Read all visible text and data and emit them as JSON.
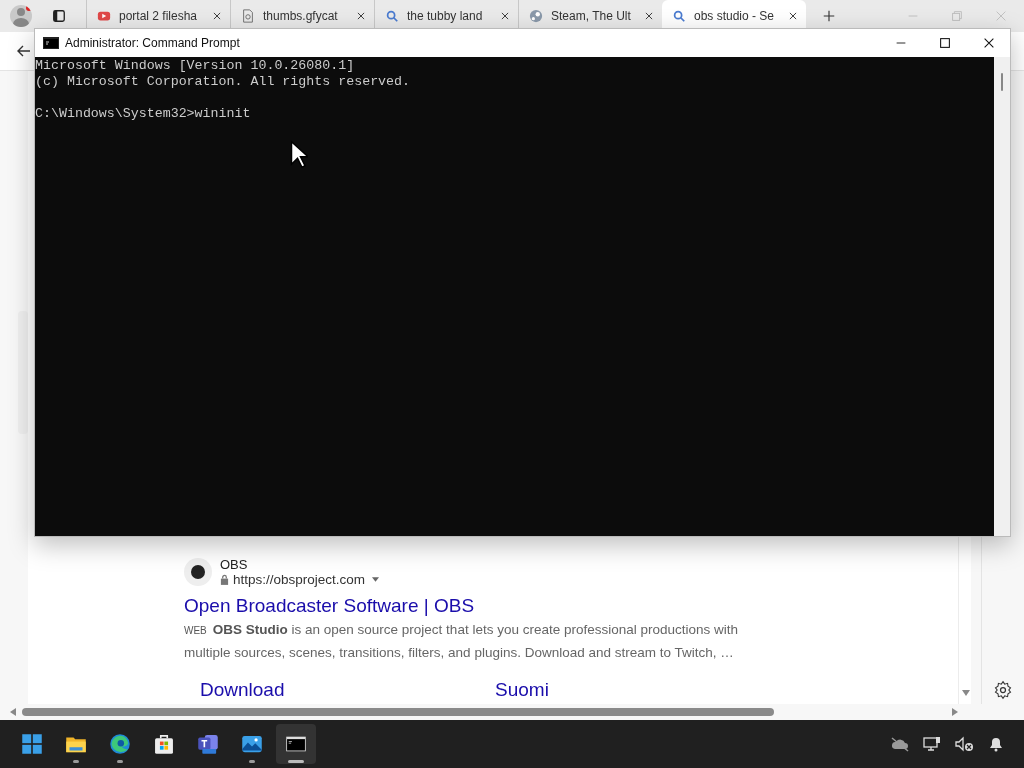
{
  "browser": {
    "tabs": [
      {
        "title": "portal 2 filesha",
        "kind": "video",
        "selected": false
      },
      {
        "title": "thumbs.gfycat",
        "kind": "document",
        "selected": false
      },
      {
        "title": "the tubby land",
        "kind": "search",
        "selected": false
      },
      {
        "title": "Steam, The Ult",
        "kind": "steam",
        "selected": false
      },
      {
        "title": "obs studio - Se",
        "kind": "search",
        "selected": true
      }
    ],
    "result": {
      "site": "OBS",
      "url": "https://obsproject.com",
      "title": "Open Broadcaster Software | OBS",
      "badge": "WEB",
      "snippet_lines": [
        "**OBS Studio** is an open source project that lets you create professional productions with",
        "multiple sources, scenes, transitions, filters, and plugins. Download and stream to Twitch, …"
      ],
      "sitelinks": [
        "Download",
        "Suomi"
      ]
    }
  },
  "console": {
    "title": "Administrator: Command Prompt",
    "lines": [
      "Microsoft Windows [Version 10.0.26080.1]",
      "(c) Microsoft Corporation. All rights reserved."
    ],
    "input_line": "C:\\Windows\\System32>wininit"
  },
  "taskbar": {
    "apps": [
      {
        "kind": "start",
        "running": false,
        "selected": false
      },
      {
        "kind": "folder",
        "running": true,
        "selected": false
      },
      {
        "kind": "edge",
        "running": true,
        "selected": false
      },
      {
        "kind": "store",
        "running": false,
        "selected": false
      },
      {
        "kind": "teams",
        "running": false,
        "selected": false
      },
      {
        "kind": "photos",
        "running": true,
        "selected": false
      },
      {
        "kind": "terminal",
        "running": true,
        "selected": true
      }
    ]
  }
}
